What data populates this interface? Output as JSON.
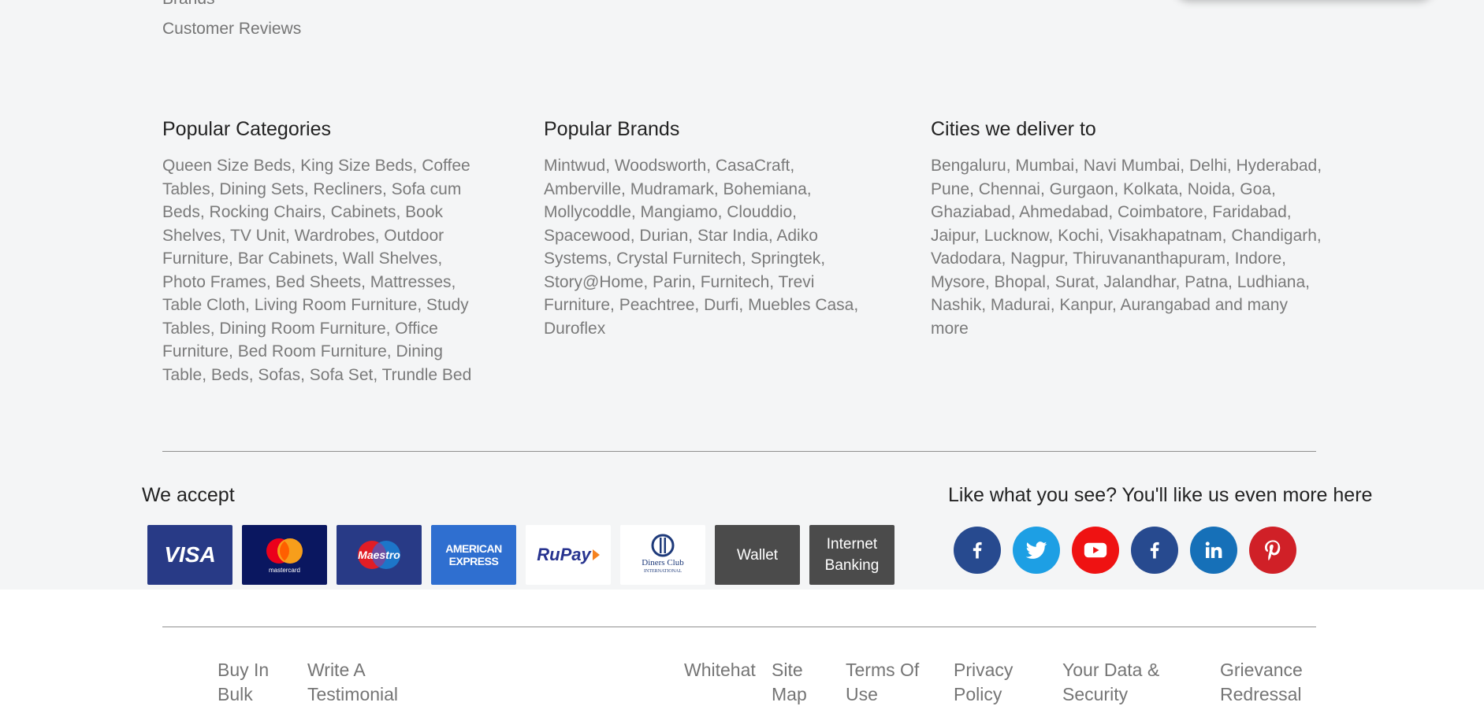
{
  "top_links": {
    "brands": "Brands",
    "customer_reviews": "Customer Reviews"
  },
  "columns": {
    "popular_categories": {
      "title": "Popular Categories",
      "text": "Queen Size Beds, King Size Beds, Coffee Tables, Dining Sets, Recliners, Sofa cum Beds, Rocking Chairs, Cabinets, Book Shelves, TV Unit, Wardrobes, Outdoor Furniture, Bar Cabinets, Wall Shelves, Photo Frames, Bed Sheets, Mattresses, Table Cloth, Living Room Furniture, Study Tables, Dining Room Furniture, Office Furniture, Bed Room Furniture, Dining Table, Beds, Sofas, Sofa Set, Trundle Bed"
    },
    "popular_brands": {
      "title": "Popular Brands",
      "text": "Mintwud, Woodsworth, CasaCraft, Amberville, Mudramark, Bohemiana, Mollycoddle, Mangiamo, Clouddio, Spacewood, Durian, Star India, Adiko Systems, Crystal Furnitech, Springtek, Story@Home, Parin, Furnitech, Trevi Furniture, Peachtree, Durfi, Muebles Casa, Duroflex"
    },
    "cities": {
      "title": "Cities we deliver to",
      "text": "Bengaluru, Mumbai, Navi Mumbai, Delhi, Hyderabad, Pune, Chennai, Gurgaon, Kolkata, Noida, Goa, Ghaziabad, Ahmedabad, Coimbatore, Faridabad, Jaipur, Lucknow, Kochi, Visakhapatnam, Chandigarh, Vadodara, Nagpur, Thiruvananthapuram, Indore, Mysore, Bhopal, Surat, Jalandhar, Patna, Ludhiana, Nashik, Madurai, Kanpur, Aurangabad and many more"
    }
  },
  "payments": {
    "title": "We accept",
    "visa": "VISA",
    "mastercard": "mastercard",
    "maestro": "Maestro",
    "amex_line1": "AMERICAN",
    "amex_line2": "EXPRESS",
    "rupay": "RuPay",
    "diners_line1": "Diners Club",
    "diners_line2": "INTERNATIONAL",
    "wallet": "Wallet",
    "netbanking_line1": "Internet",
    "netbanking_line2": "Banking"
  },
  "social": {
    "title": "Like what you see? You'll like us even more here",
    "icons": [
      "facebook-icon",
      "twitter-icon",
      "youtube-icon",
      "facebook-icon",
      "linkedin-icon",
      "pinterest-icon"
    ],
    "colors": {
      "facebook": "#274a8f",
      "twitter": "#1d9fe4",
      "youtube": "#ef1212",
      "linkedin": "#1670b8",
      "pinterest": "#d02027"
    }
  },
  "footer_links": {
    "buy_in_bulk": [
      "Buy In",
      "Bulk"
    ],
    "write_testimonial": [
      "Write A",
      "Testimonial"
    ],
    "whitehat": [
      "Whitehat"
    ],
    "site_map": [
      "Site",
      "Map"
    ],
    "terms": [
      "Terms Of",
      "Use"
    ],
    "privacy": [
      "Privacy",
      "Policy"
    ],
    "data_security": [
      "Your Data &",
      "Security"
    ],
    "grievance": [
      "Grievance",
      "Redressal"
    ]
  }
}
